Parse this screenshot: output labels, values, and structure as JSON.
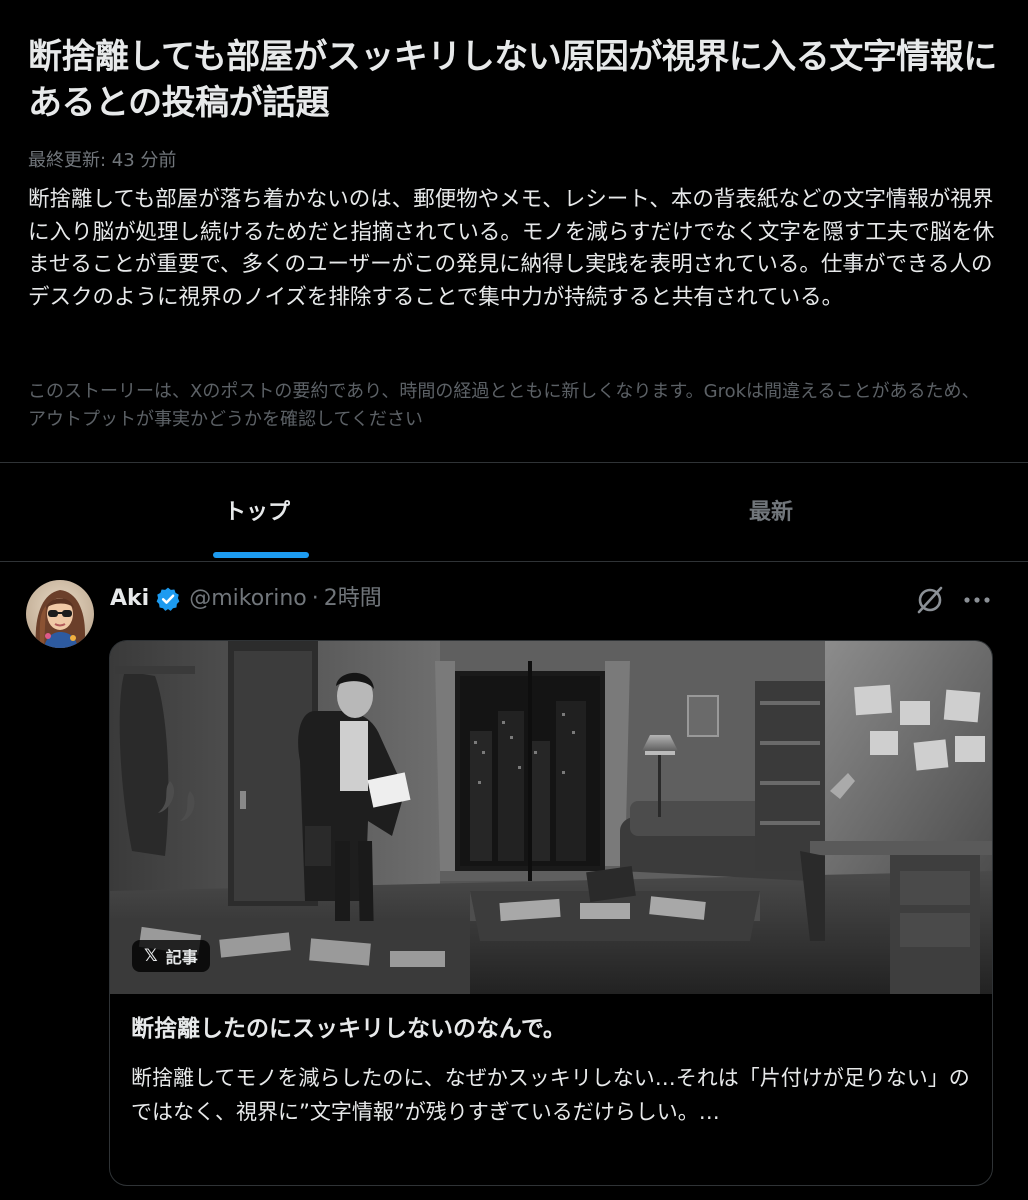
{
  "story": {
    "title": "断捨離しても部屋がスッキリしない原因が視界に入る文字情報にあるとの投稿が話題",
    "updated": "最終更新: 43 分前",
    "summary": "断捨離しても部屋が落ち着かないのは、郵便物やメモ、レシート、本の背表紙などの文字情報が視界に入り脳が処理し続けるためだと指摘されている。モノを減らすだけでなく文字を隠す工夫で脳を休ませることが重要で、多くのユーザーがこの発見に納得し実践を表明されている。仕事ができる人のデスクのように視界のノイズを排除することで集中力が持続すると共有されている。",
    "disclaimer": "このストーリーは、Xのポストの要約であり、時間の経過とともに新しくなります。Grokは間違えることがあるため、アウトプットが事実かどうかを確認してください"
  },
  "tabs": [
    {
      "label": "トップ",
      "active": true
    },
    {
      "label": "最新",
      "active": false
    }
  ],
  "post": {
    "author_name": "Aki",
    "handle": "@mikorino",
    "separator": "·",
    "time": "2時間",
    "verified": true,
    "card": {
      "badge_x": "𝕏",
      "badge_label": "記事",
      "title": "断捨離したのにスッキリしないのなんで。",
      "description": "断捨離してモノを減らしたのに、なぜかスッキリしない…それは「片付けが足りない」のではなく、視界に”文字情報”が残りすぎているだけらしい。…"
    }
  },
  "colors": {
    "background": "#000000",
    "text_primary": "#e7e9ea",
    "text_secondary": "#71767b",
    "accent": "#1d9bf0",
    "border": "#2f3336"
  }
}
